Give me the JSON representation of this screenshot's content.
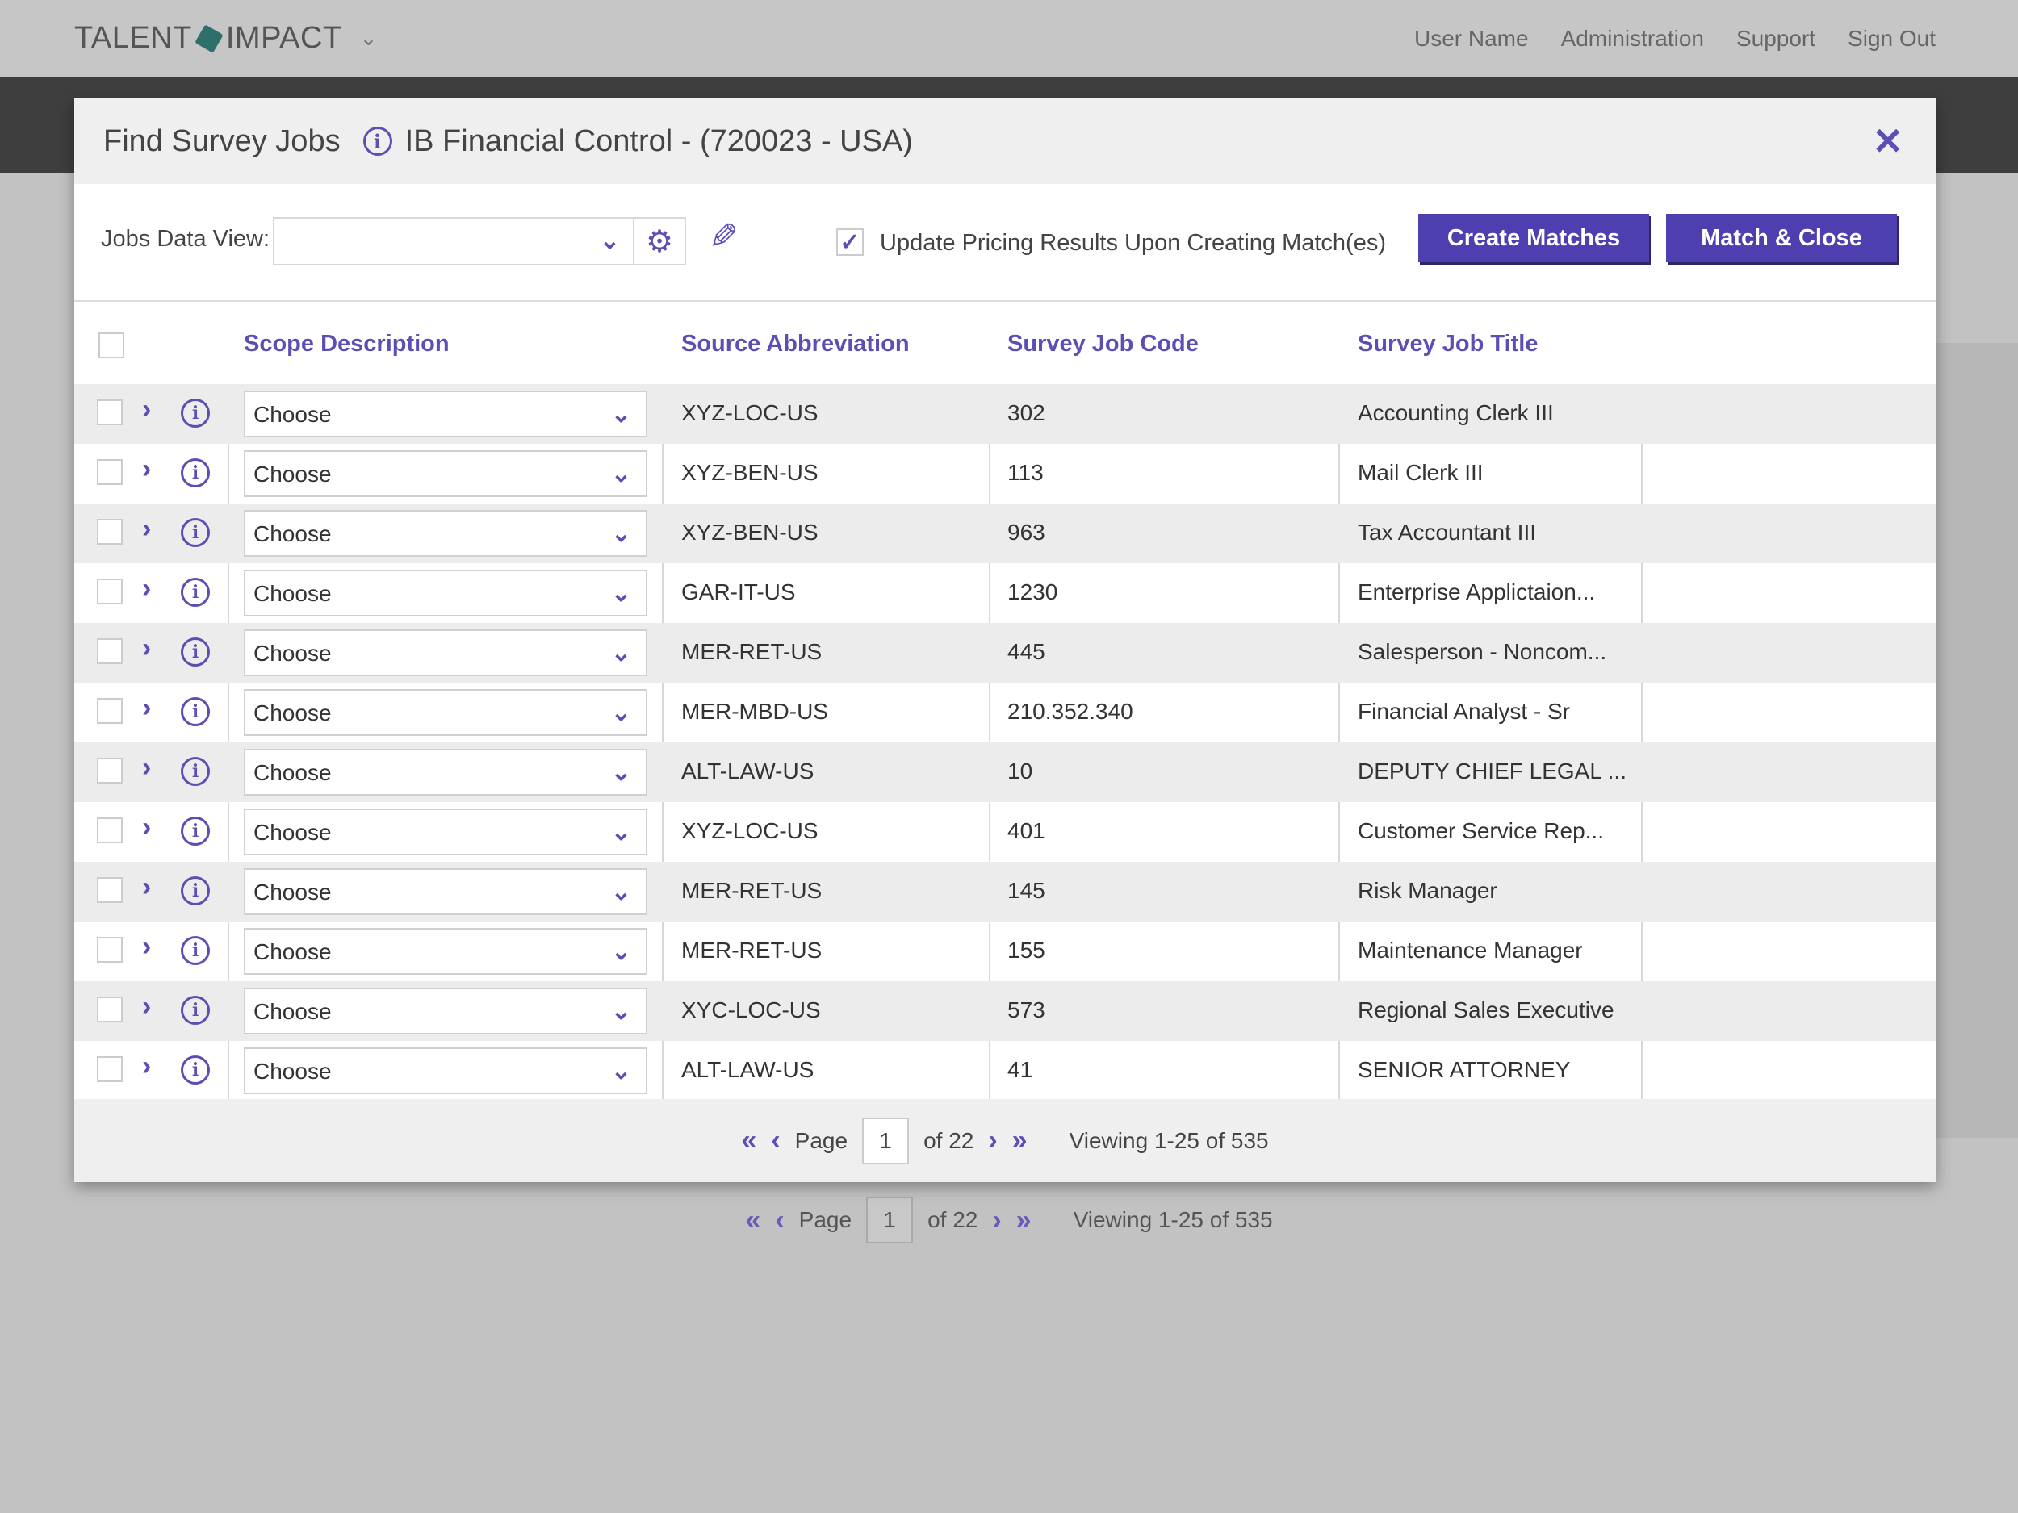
{
  "app": {
    "brand_left": "TALENT",
    "brand_right": "IMPACT",
    "nav": [
      "User Name",
      "Administration",
      "Support",
      "Sign Out"
    ]
  },
  "modal": {
    "title": "Find Survey Jobs",
    "subtitle": "IB Financial Control - (720023 - USA)",
    "close_glyph": "✕"
  },
  "toolbar": {
    "jobs_view_label": "Jobs Data View:",
    "jobs_view_value": "",
    "update_checkbox_checked": true,
    "update_label": "Update Pricing Results Upon Creating Match(es)",
    "create_matches_label": "Create Matches",
    "match_close_label": "Match & Close"
  },
  "table": {
    "columns": [
      "Scope Description",
      "Source Abbreviation",
      "Survey Job Code",
      "Survey Job Title"
    ],
    "rows": [
      {
        "scope": "Choose",
        "source": "XYZ-LOC-US",
        "code": "302",
        "title": "Accounting Clerk III"
      },
      {
        "scope": "Choose",
        "source": "XYZ-BEN-US",
        "code": "113",
        "title": "Mail Clerk III"
      },
      {
        "scope": "Choose",
        "source": "XYZ-BEN-US",
        "code": "963",
        "title": "Tax Accountant III"
      },
      {
        "scope": "Choose",
        "source": "GAR-IT-US",
        "code": "1230",
        "title": "Enterprise Applictaion..."
      },
      {
        "scope": "Choose",
        "source": "MER-RET-US",
        "code": "445",
        "title": "Salesperson - Noncom..."
      },
      {
        "scope": "Choose",
        "source": "MER-MBD-US",
        "code": "210.352.340",
        "title": "Financial Analyst - Sr"
      },
      {
        "scope": "Choose",
        "source": "ALT-LAW-US",
        "code": "10",
        "title": "DEPUTY CHIEF LEGAL ..."
      },
      {
        "scope": "Choose",
        "source": "XYZ-LOC-US",
        "code": "401",
        "title": "Customer Service Rep..."
      },
      {
        "scope": "Choose",
        "source": "MER-RET-US",
        "code": "145",
        "title": "Risk Manager"
      },
      {
        "scope": "Choose",
        "source": "MER-RET-US",
        "code": "155",
        "title": "Maintenance Manager"
      },
      {
        "scope": "Choose",
        "source": "XYC-LOC-US",
        "code": "573",
        "title": "Regional Sales Executive"
      },
      {
        "scope": "Choose",
        "source": "ALT-LAW-US",
        "code": "41",
        "title": "SENIOR ATTORNEY"
      }
    ]
  },
  "pager": {
    "page_label": "Page",
    "page": "1",
    "of_label": "of 22",
    "viewing": "Viewing 1-25 of 535"
  },
  "colors": {
    "accent": "#5b4fb5",
    "button": "#4e3fb0",
    "brand_cube": "#2f6f6a"
  }
}
